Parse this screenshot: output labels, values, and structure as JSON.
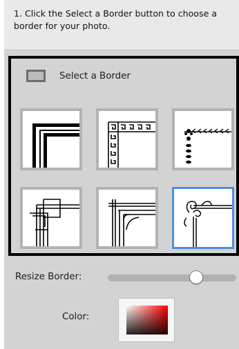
{
  "instruction": {
    "text": "1. Click the Select a Border button to choose a border for your photo."
  },
  "select_border": {
    "label": "Select a Border",
    "icon": "border-frame-icon"
  },
  "borders": [
    {
      "name": "thick-double-line",
      "selected": false
    },
    {
      "name": "greek-key",
      "selected": false
    },
    {
      "name": "leaf-vine",
      "selected": false
    },
    {
      "name": "interlaced-lines",
      "selected": false
    },
    {
      "name": "curved-inner-corner",
      "selected": false
    },
    {
      "name": "scroll-flourish",
      "selected": true
    }
  ],
  "resize": {
    "label": "Resize Border:",
    "value_fraction": 0.69
  },
  "color": {
    "label": "Color:",
    "swatch_from": "#ffffff",
    "swatch_to": "#ff0000"
  },
  "accent_colors": {
    "selected_tile": "#4d8fe0",
    "panel_outline": "#000000",
    "panel_background": "#d3d3d3"
  }
}
